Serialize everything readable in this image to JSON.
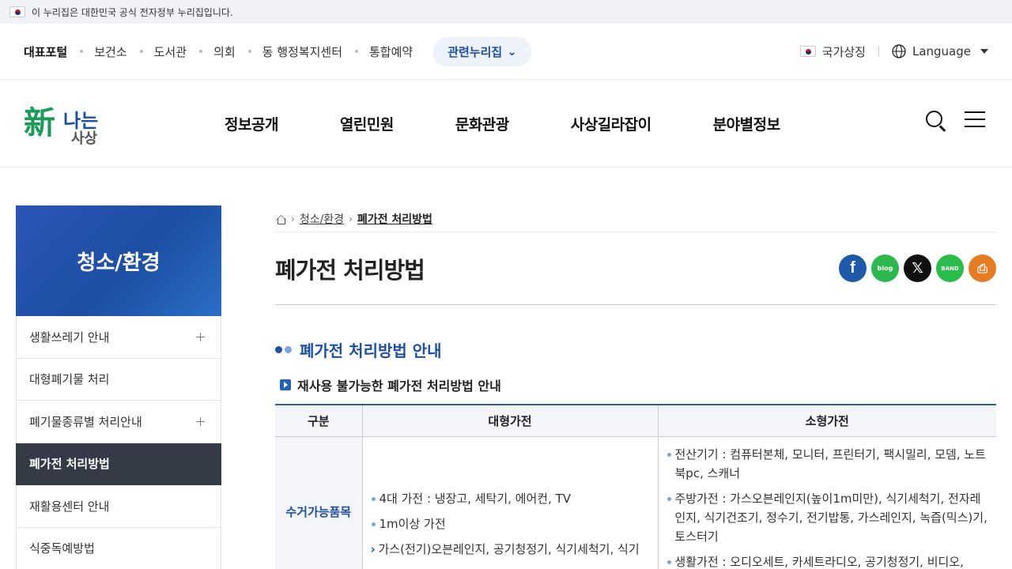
{
  "gov_banner": {
    "text": "이 누리집은 대한민국 공식 전자정부 누리집입니다."
  },
  "util": {
    "links": [
      "대표포털",
      "보건소",
      "도서관",
      "의회",
      "동 행정복지센터",
      "통합예약"
    ],
    "related": "관련누리집",
    "national_symbol": "국가상징",
    "language": "Language"
  },
  "logo": {
    "sin": "新",
    "na": "나는",
    "sa": "사상"
  },
  "menu": [
    "정보공개",
    "열린민원",
    "문화관광",
    "사상길라잡이",
    "분야별정보"
  ],
  "lnb": {
    "title": "청소/환경",
    "items": [
      {
        "label": "생활쓰레기 안내"
      },
      {
        "label": "대형폐기물 처리"
      },
      {
        "label": "폐기물종류별 처리안내"
      },
      {
        "label": "폐가전 처리방법"
      },
      {
        "label": "재활용센터 안내"
      },
      {
        "label": "식중독예방법"
      }
    ]
  },
  "breadcrumb": {
    "section": "청소/환경",
    "current": "폐가전 처리방법"
  },
  "page": {
    "title": "폐가전 처리방법",
    "share": {
      "facebook": "f",
      "blog": "blog",
      "x": "𝕏",
      "band": "BAND",
      "print": "⎙"
    },
    "section_title": "폐가전 처리방법 안내",
    "sub_title": "재사용 불가능한 폐가전 처리방법 안내"
  },
  "table": {
    "headers": [
      "구분",
      "대형가전",
      "소형가전"
    ],
    "row_label": "수거가능품목",
    "large": [
      "4대 가전 : 냉장고, 세탁기, 에어컨, TV",
      "1m이상 가전"
    ],
    "large_sub": "가스(전기)오븐레인지, 공기청정기, 식기세척기, 식기",
    "small": [
      "전산기기 : 컴퓨터본체, 모니터, 프린터기, 팩시밀리, 모뎀, 노트북pc, 스캐너",
      "주방가전 : 가스오븐레인지(높이1m미만), 식기세척기, 전자레인지, 식기건조기, 정수기, 전기밥통, 가스레인지, 녹즙(믹스)기, 토스터기",
      "생활가전 : 오디오세트, 카세트라디오, 공기청정기, 비디오,"
    ]
  }
}
